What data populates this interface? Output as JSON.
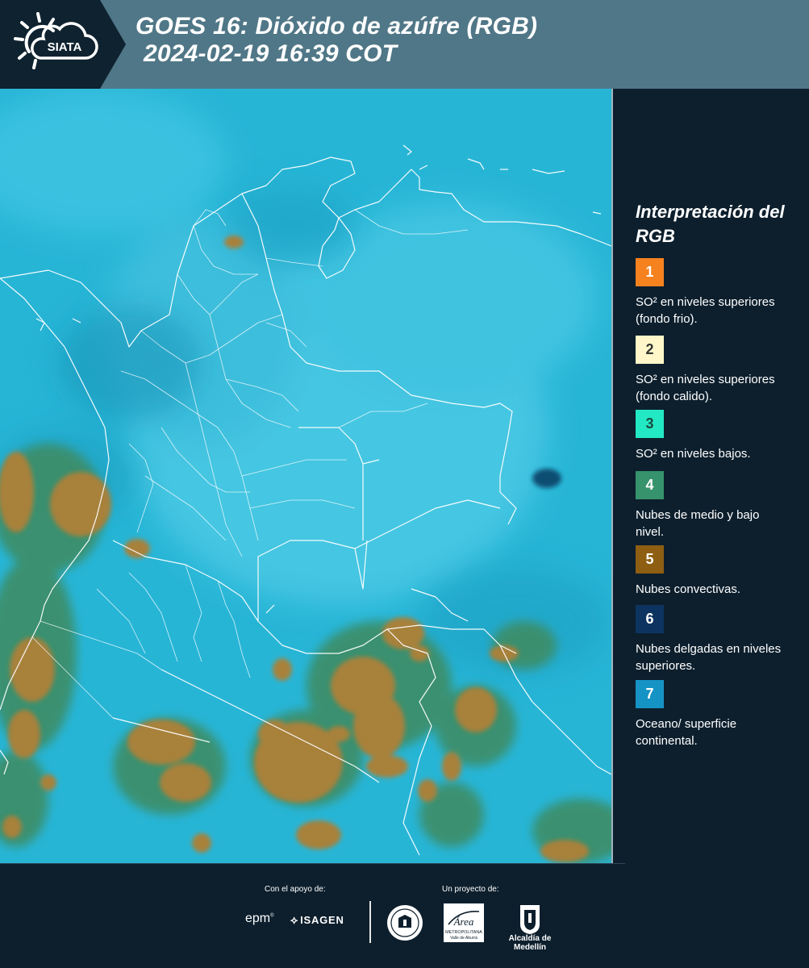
{
  "header": {
    "logo_text": "SIATA",
    "title_line1": "GOES 16: Dióxido de azúfre (RGB)",
    "title_line2": "2024-02-19 16:39 COT",
    "band_color": "#507787",
    "badge_color": "#0f2230"
  },
  "map": {
    "description_icon": "satellite-rgb-map",
    "background_color": "#27b5d6",
    "border_color": "#ffffff"
  },
  "legend": {
    "title": "Interpretación del RGB",
    "items": [
      {
        "number": "1",
        "color": "#f5821f",
        "text_color": "#ffffff",
        "description": "SO² en niveles superiores (fondo frio)."
      },
      {
        "number": "2",
        "color": "#fff7c9",
        "text_color": "#333333",
        "description": "SO² en niveles superiores (fondo calido)."
      },
      {
        "number": "3",
        "color": "#23e8c4",
        "text_color": "#1a4a40",
        "description": "SO² en niveles bajos."
      },
      {
        "number": "4",
        "color": "#36936b",
        "text_color": "#ffffff",
        "description": "Nubes de medio y bajo nivel."
      },
      {
        "number": "5",
        "color": "#8e5e12",
        "text_color": "#ffffff",
        "description": "Nubes convectivas."
      },
      {
        "number": "6",
        "color": "#0d3460",
        "text_color": "#ffffff",
        "description": "Nubes delgadas en niveles superiores."
      },
      {
        "number": "7",
        "color": "#1593c4",
        "text_color": "#ffffff",
        "description": "Oceano/ superficie continental."
      }
    ]
  },
  "footer": {
    "support_label": "Con el apoyo de:",
    "project_label": "Un proyecto de:",
    "epm": "epm",
    "isagen": "ISAGEN",
    "area": "Área",
    "area_sub": "METROPOLITANA",
    "area_sub2": "Valle de Aburrá",
    "alcaldia": "Alcaldía de Medellín",
    "seal_text": "MEDELLÍN"
  }
}
